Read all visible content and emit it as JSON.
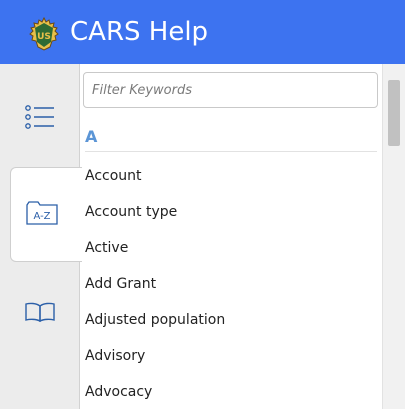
{
  "header": {
    "title": "CARS Help",
    "logo_icon": "usda-forest-service-shield-icon",
    "logo_lettering": "US",
    "background_color": "#3d73f0"
  },
  "rail": {
    "items": [
      {
        "name": "contents",
        "icon": "list-icon",
        "active": false
      },
      {
        "name": "index",
        "icon": "a-z-index-icon",
        "icon_text": "A-Z",
        "active": true
      },
      {
        "name": "glossary",
        "icon": "open-book-icon",
        "active": false
      }
    ],
    "icon_color": "#2b5fa8"
  },
  "filter": {
    "placeholder": "Filter Keywords",
    "value": ""
  },
  "index": {
    "letter": "A",
    "letter_color": "#5b95d6",
    "terms": [
      "Account",
      "Account type",
      "Active",
      "Add Grant",
      "Adjusted population",
      "Advisory",
      "Advocacy"
    ]
  }
}
